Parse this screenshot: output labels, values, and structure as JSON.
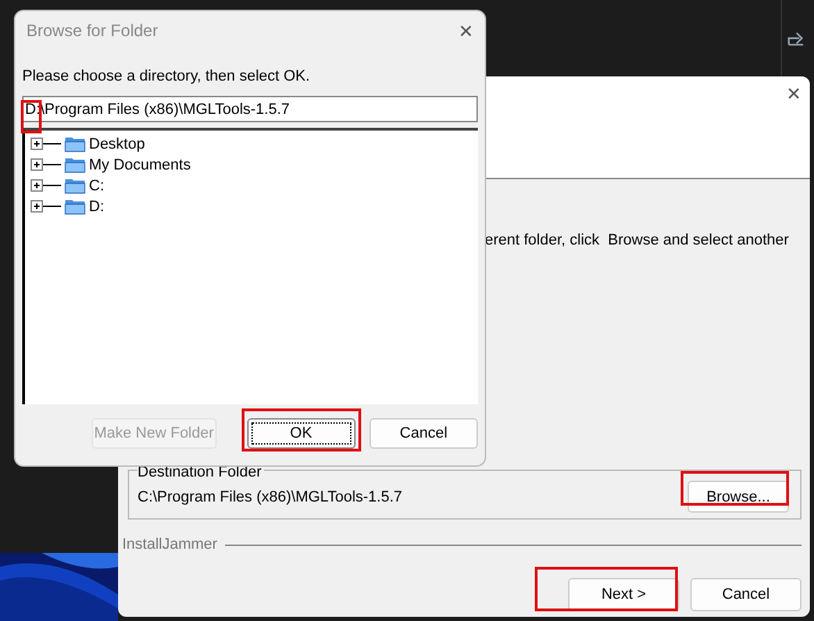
{
  "installer": {
    "close_glyph": "✕",
    "body_text": "erent folder, click  Browse and select another",
    "destination": {
      "label": "Destination Folder",
      "path": "C:\\Program Files (x86)\\MGLTools-1.5.7",
      "browse_button": "Browse..."
    },
    "brand": "InstallJammer",
    "buttons": [
      {
        "label": "Next >",
        "disabled": false
      },
      {
        "label": "Cancel",
        "disabled": false
      }
    ]
  },
  "dialog": {
    "title": "Browse for Folder",
    "close_glyph": "✕",
    "prompt": "Please choose a directory, then select OK.",
    "path_value": "D:\\Program Files (x86)\\MGLTools-1.5.7",
    "tree": [
      {
        "label": "Desktop",
        "expanded": false
      },
      {
        "label": "My Documents",
        "expanded": false
      },
      {
        "label": "C:",
        "expanded": false
      },
      {
        "label": "D:",
        "expanded": false
      }
    ],
    "buttons": [
      {
        "label": "Make New Folder",
        "disabled": true,
        "focused": false
      },
      {
        "label": "OK",
        "disabled": false,
        "focused": true
      },
      {
        "label": "Cancel",
        "disabled": false,
        "focused": false
      }
    ]
  }
}
